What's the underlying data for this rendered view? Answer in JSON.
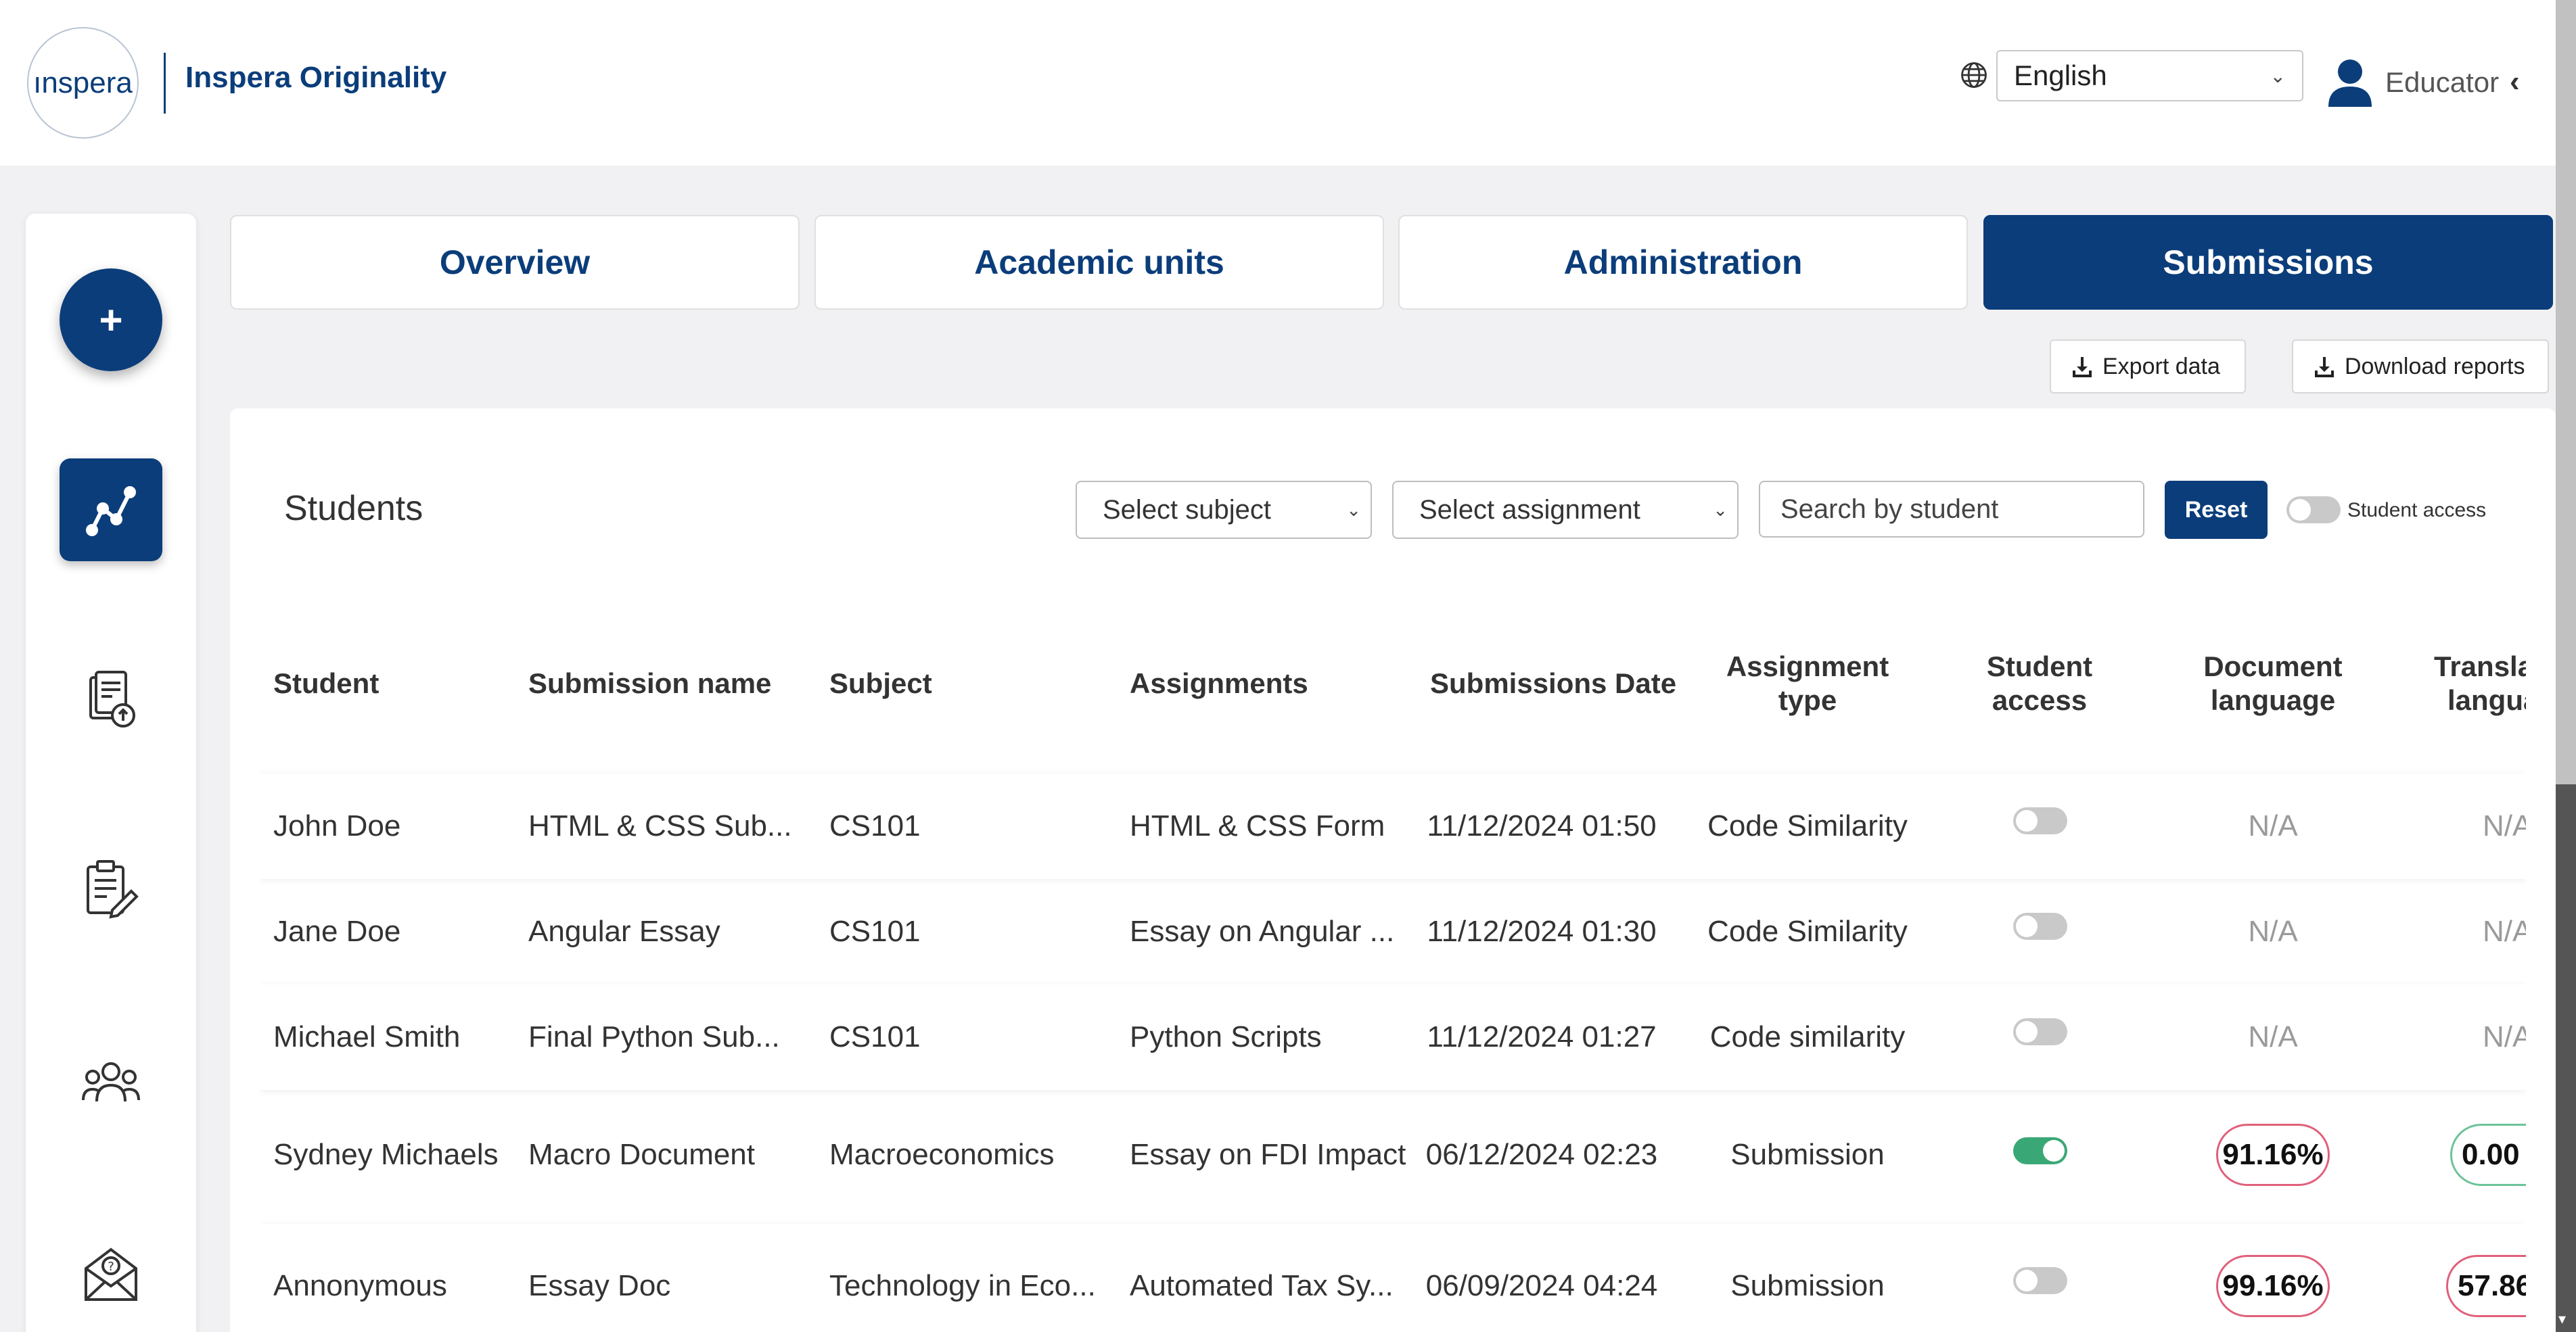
{
  "app": {
    "logo_text": "ınspera",
    "title": "Inspera Originality"
  },
  "header": {
    "language": "English",
    "role": "Educator",
    "role_chevron": "‹"
  },
  "sidebar": {
    "fab_label": "+",
    "items": [
      {
        "name": "analytics-icon",
        "active": true
      },
      {
        "name": "document-upload-icon",
        "active": false
      },
      {
        "name": "clipboard-edit-icon",
        "active": false
      },
      {
        "name": "users-group-icon",
        "active": false
      },
      {
        "name": "mail-help-icon",
        "active": false
      }
    ]
  },
  "tabs": [
    {
      "label": "Overview",
      "active": false
    },
    {
      "label": "Academic units",
      "active": false
    },
    {
      "label": "Administration",
      "active": false
    },
    {
      "label": "Submissions",
      "active": true
    }
  ],
  "actions": {
    "export_label": "Export data",
    "download_label": "Download reports"
  },
  "students": {
    "title": "Students",
    "subject_select": "Select subject",
    "assignment_select": "Select assignment",
    "search_placeholder": "Search by student",
    "reset_label": "Reset",
    "student_access_label": "Student access",
    "student_access_on": false
  },
  "table": {
    "headers": {
      "student": "Student",
      "submission_name": "Submission name",
      "subject": "Subject",
      "assignments": "Assignments",
      "date": "Submissions Date",
      "assignment_type_1": "Assignment",
      "assignment_type_2": "type",
      "student_access_1": "Student",
      "student_access_2": "access",
      "doc_lang_1": "Document",
      "doc_lang_2": "language",
      "trans_lang_1": "Transla",
      "trans_lang_2": "langua"
    },
    "rows": [
      {
        "student": "John Doe",
        "submission": "HTML & CSS Sub...",
        "subject": "CS101",
        "assignment": "HTML & CSS Form",
        "date": "11/12/2024 01:50",
        "type": "Code Similarity",
        "access_on": false,
        "doc_lang": "N/A",
        "trans_lang": "N/A"
      },
      {
        "student": "Jane Doe",
        "submission": "Angular Essay",
        "subject": "CS101",
        "assignment": "Essay on Angular ...",
        "date": "11/12/2024 01:30",
        "type": "Code Similarity",
        "access_on": false,
        "doc_lang": "N/A",
        "trans_lang": "N/A"
      },
      {
        "student": "Michael Smith",
        "submission": "Final Python Sub...",
        "subject": "CS101",
        "assignment": "Python Scripts",
        "date": "11/12/2024 01:27",
        "type": "Code similarity",
        "access_on": false,
        "doc_lang": "N/A",
        "trans_lang": "N/A"
      },
      {
        "student": "Sydney Michaels",
        "submission": "Macro Document",
        "subject": "Macroeconomics",
        "assignment": "Essay on FDI Impact",
        "date": "06/12/2024 02:23",
        "type": "Submission",
        "access_on": true,
        "doc_lang": "91.16%",
        "trans_lang": "0.00"
      },
      {
        "student": "Annonymous",
        "submission": "Essay Doc",
        "subject": "Technology in Eco...",
        "assignment": "Automated Tax Sy...",
        "date": "06/09/2024 04:24",
        "type": "Submission",
        "access_on": false,
        "doc_lang": "99.16%",
        "trans_lang": "57.86"
      }
    ]
  },
  "colors": {
    "brand": "#0b3d7a",
    "toggle_on": "#3aa876",
    "score_high": "#e0607a",
    "score_low": "#6cc39a"
  }
}
